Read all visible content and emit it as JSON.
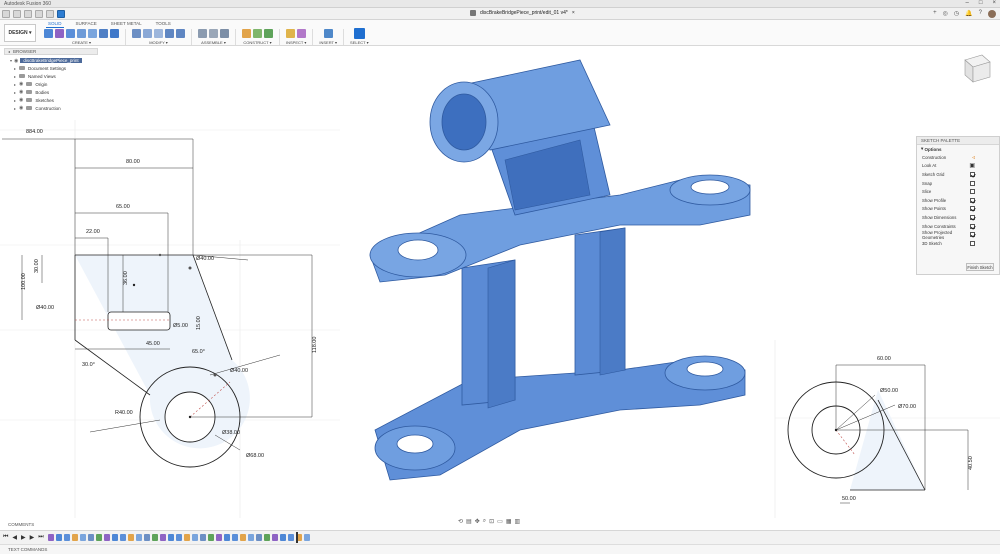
{
  "app": {
    "title": "Autodesk Fusion 360",
    "document_name": "discBrakeBridgePiece_print/edit_01 v4*"
  },
  "toolbar": {
    "workspace_label": "DESIGN ▾",
    "tabs": [
      "SOLID",
      "SURFACE",
      "SHEET METAL",
      "TOOLS"
    ],
    "active_tab": "SOLID",
    "groups": [
      {
        "label": "CREATE ▾"
      },
      {
        "label": "MODIFY ▾"
      },
      {
        "label": "ASSEMBLE ▾"
      },
      {
        "label": "CONSTRUCT ▾"
      },
      {
        "label": "INSPECT ▾"
      },
      {
        "label": "INSERT ▾"
      },
      {
        "label": "SELECT ▾"
      }
    ]
  },
  "browser": {
    "header": "BROWSER",
    "root": "discBrakeBridgePiece_print",
    "items": [
      {
        "label": "Document Settings"
      },
      {
        "label": "Named Views"
      },
      {
        "label": "Origin"
      },
      {
        "label": "Bodies"
      },
      {
        "label": "Sketches"
      },
      {
        "label": "Construction"
      }
    ]
  },
  "sketch_palette": {
    "header": "SKETCH PALETTE",
    "section": "Options",
    "rows": [
      {
        "label": "Construction",
        "kind": "icon",
        "icon": "construction-icon"
      },
      {
        "label": "Look At",
        "kind": "icon",
        "icon": "look-at-icon"
      },
      {
        "label": "Sketch Grid",
        "kind": "check",
        "checked": true
      },
      {
        "label": "Snap",
        "kind": "check",
        "checked": false
      },
      {
        "label": "Slice",
        "kind": "check",
        "checked": false
      },
      {
        "label": "Show Profile",
        "kind": "check",
        "checked": true
      },
      {
        "label": "Show Points",
        "kind": "check",
        "checked": true
      },
      {
        "label": "Show Dimensions",
        "kind": "check",
        "checked": true
      },
      {
        "label": "Show Constraints",
        "kind": "check",
        "checked": true
      },
      {
        "label": "Show Projected Geometries",
        "kind": "check",
        "checked": true
      },
      {
        "label": "3D Sketch",
        "kind": "check",
        "checked": false
      }
    ],
    "finish_label": "Finish Sketch"
  },
  "dimensions_left": {
    "d1": "884.00",
    "d2": "80.00",
    "d3": "65.00",
    "d4": "22.00",
    "d5": "30.00",
    "d6": "100.00",
    "d7": "36.00",
    "d8": "Ø40.00",
    "d9": "Ø40.00",
    "d10": "15.00",
    "d11": "Ø5.00",
    "d12": "45.00",
    "d13": "30.0°",
    "d14": "65.0°",
    "d15": "118.00",
    "d16": "Ø40.00",
    "d17": "R40.00",
    "d18": "Ø38.00",
    "d19": "Ø68.00",
    "d20": "R40.00"
  },
  "dimensions_right": {
    "d1": "60.00",
    "d2": "Ø50.00",
    "d3": "Ø70.00",
    "d4": "40.50",
    "d5": "50.00"
  },
  "bottom": {
    "comments": "COMMENTS",
    "text_commands": "TEXT COMMANDS"
  },
  "colors": {
    "model_blue": "#6f9ee0",
    "model_dark": "#3d6fbf",
    "accent": "#1f6fd0"
  }
}
